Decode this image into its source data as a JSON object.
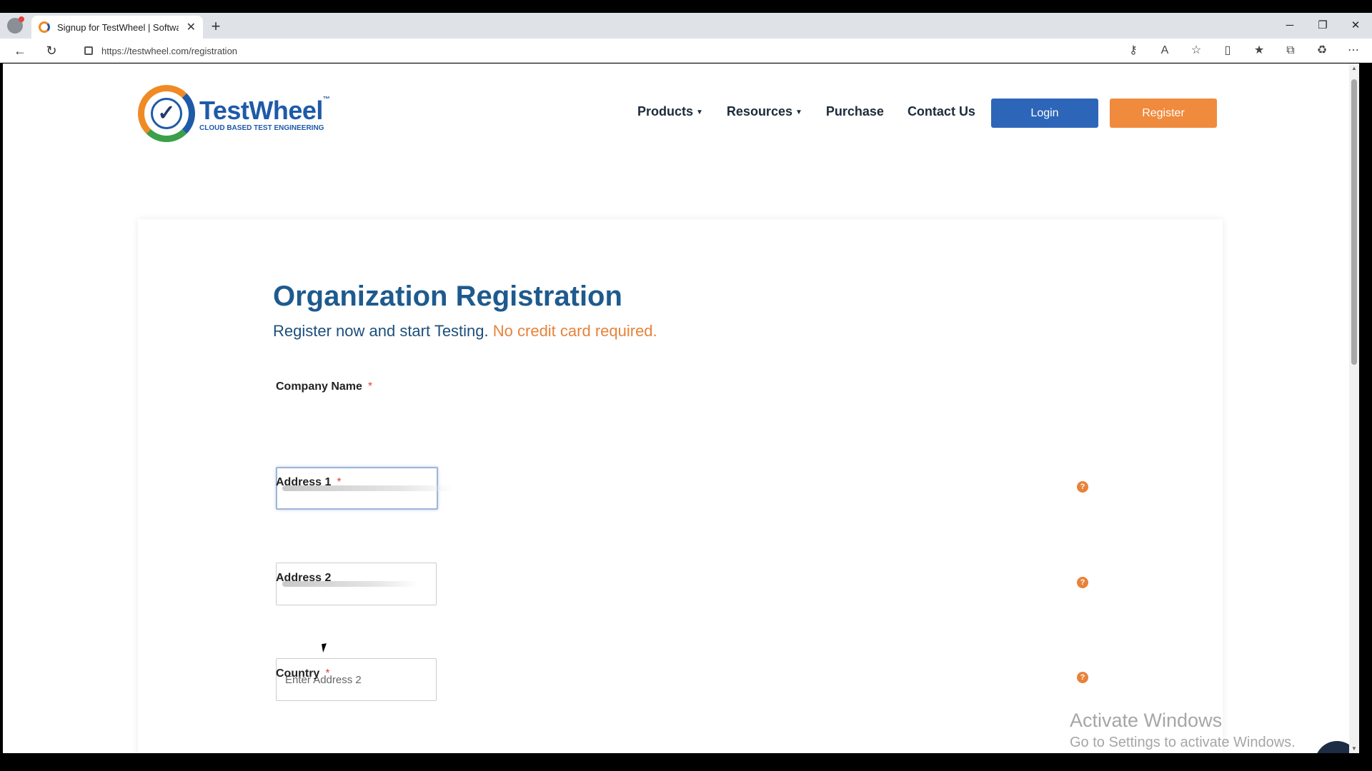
{
  "browser": {
    "tab_title": "Signup for TestWheel | Software",
    "url": "https://testwheel.com/registration",
    "window_controls": [
      "minimize",
      "restore",
      "close"
    ]
  },
  "site": {
    "logo_name": "TestWheel",
    "logo_tm": "™",
    "logo_tagline": "CLOUD BASED TEST ENGINEERING",
    "nav": {
      "products": "Products",
      "resources": "Resources",
      "purchase": "Purchase",
      "contact": "Contact Us"
    },
    "login_label": "Login",
    "register_label": "Register"
  },
  "form": {
    "title": "Organization Registration",
    "subtitle_main": "Register now and start Testing.",
    "subtitle_accent": "No credit card required.",
    "required_mark": "*",
    "help_glyph": "?",
    "fields": {
      "company": {
        "label": "Company Name",
        "placeholder": "",
        "required": true
      },
      "address1": {
        "label": "Address 1",
        "placeholder": "",
        "required": true
      },
      "address2": {
        "label": "Address 2",
        "placeholder": "Enter Address 2",
        "required": false
      },
      "country": {
        "label": "Country",
        "placeholder": "",
        "required": true
      }
    }
  },
  "watermark": {
    "line1": "Activate Windows",
    "line2": "Go to Settings to activate Windows."
  },
  "colors": {
    "brand_blue": "#1e5aa8",
    "brand_orange": "#f08a3c",
    "login_button": "#2d66b8",
    "title_blue": "#1e5a8e",
    "chat_bg": "#1e2d45"
  }
}
